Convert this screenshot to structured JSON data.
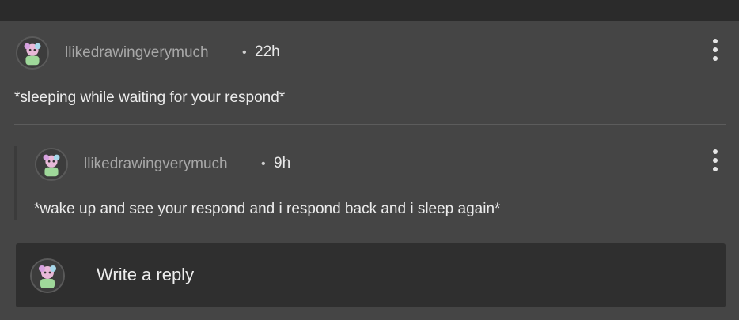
{
  "comment": {
    "username": "llikedrawingverymuch",
    "separator": "•",
    "time": "22h",
    "text": "*sleeping while waiting for your respond*"
  },
  "reply": {
    "username": "llikedrawingverymuch",
    "separator": "•",
    "time": "9h",
    "text": "*wake up and see your respond and i respond back and i sleep again*"
  },
  "reply_box": {
    "placeholder": "Write a reply"
  },
  "icons": {
    "more": "more-vertical-icon",
    "avatar": "avatar"
  },
  "colors": {
    "card_bg": "#454545",
    "page_bg": "#2b2b2b",
    "reply_bg": "#2f2f2f",
    "username": "#a7a7a7",
    "text": "#ececec"
  }
}
